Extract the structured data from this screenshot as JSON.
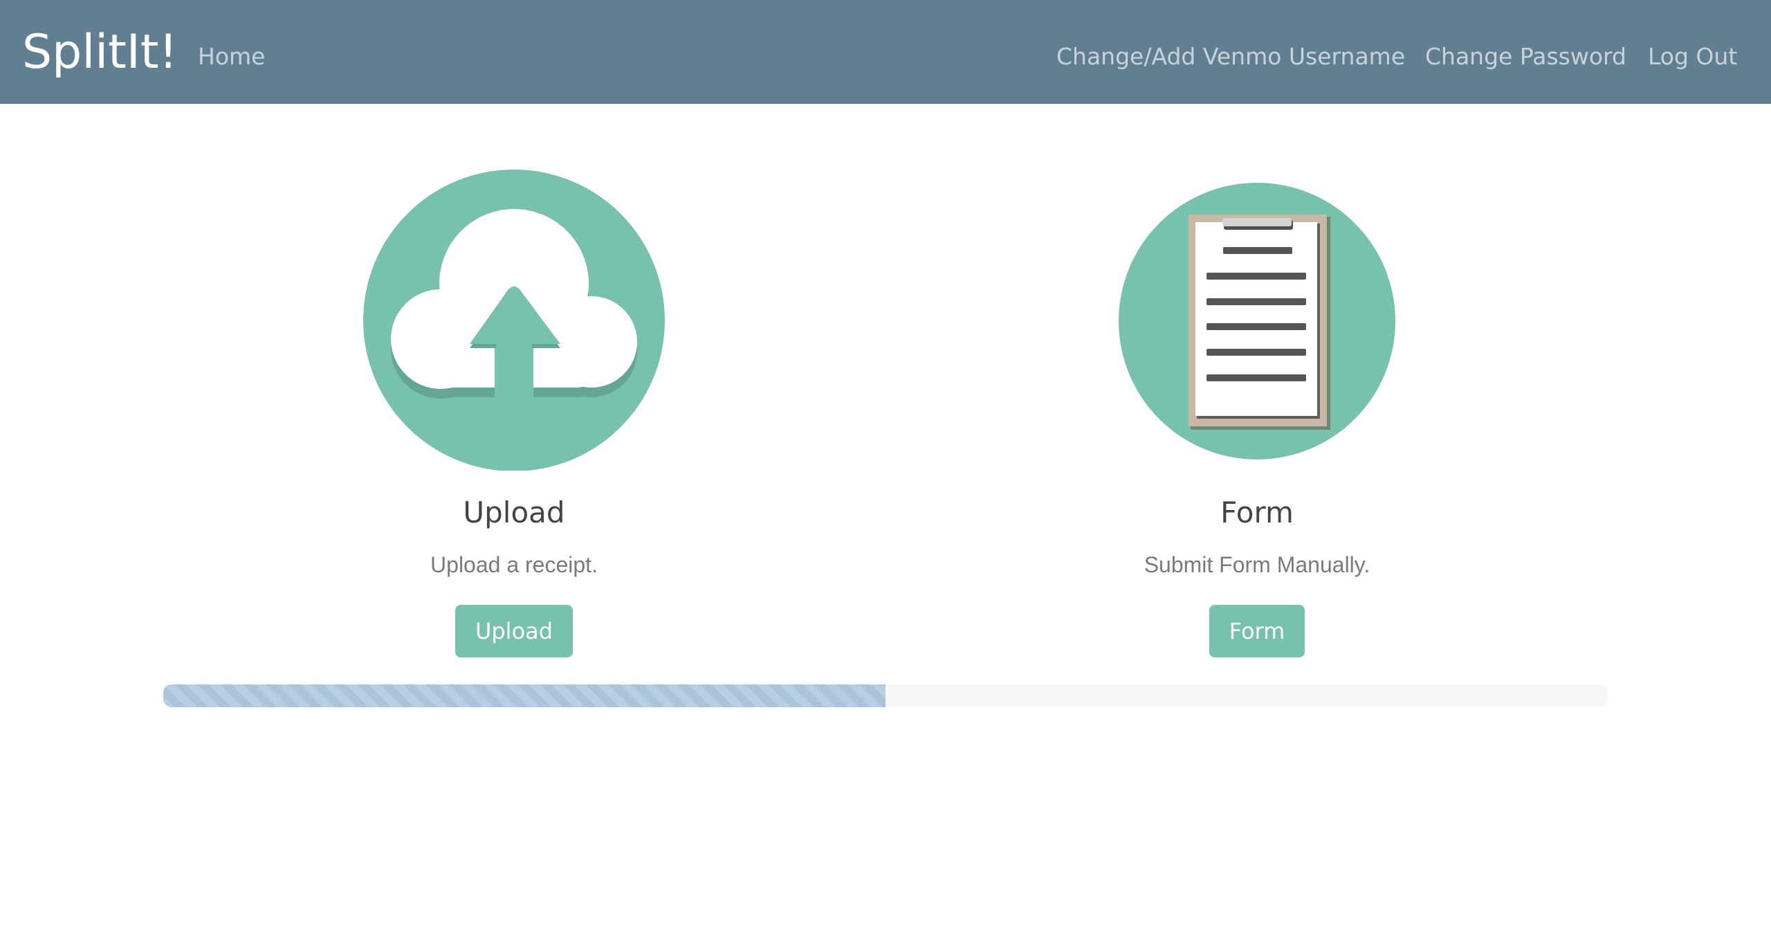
{
  "navbar": {
    "brand": "SplitIt!",
    "home": "Home",
    "venmo": "Change/Add Venmo Username",
    "password": "Change Password",
    "logout": "Log Out"
  },
  "cards": {
    "upload": {
      "icon": "cloud-upload-icon",
      "title": "Upload",
      "text": "Upload a receipt.",
      "button": "Upload"
    },
    "form": {
      "icon": "clipboard-icon",
      "title": "Form",
      "text": "Submit Form Manually.",
      "button": "Form"
    }
  },
  "progress": {
    "percent": 50
  },
  "colors": {
    "navbar": "#627f92",
    "accent": "#78c2ad",
    "progress_fill": "#a9c4db",
    "progress_track": "#f6f7f9"
  }
}
